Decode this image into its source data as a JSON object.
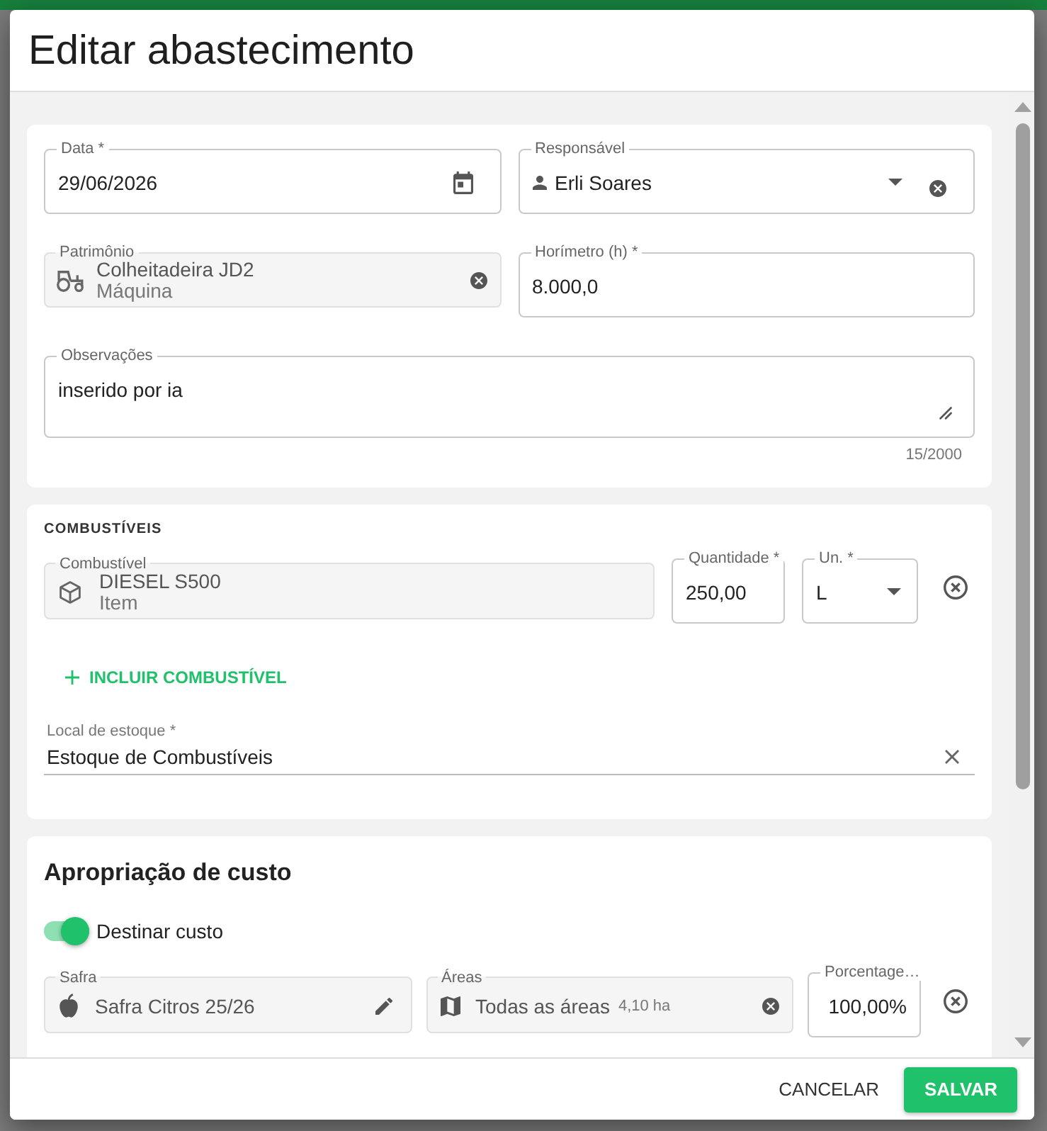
{
  "dialog": {
    "title": "Editar abastecimento"
  },
  "general": {
    "date": {
      "label": "Data *",
      "value": "29/06/2026"
    },
    "responsible": {
      "label": "Responsável",
      "value": "Erli Soares"
    },
    "asset": {
      "label": "Patrimônio",
      "name": "Colheitadeira JD2",
      "type": "Máquina"
    },
    "hour_meter": {
      "label": "Horímetro (h) *",
      "value": "8.000,0"
    },
    "notes": {
      "label": "Observações",
      "value": "inserido por ia",
      "counter": "15/2000"
    }
  },
  "fuels": {
    "heading": "COMBUSTÍVEIS",
    "items": [
      {
        "label": "Combustível",
        "name": "DIESEL S500",
        "type": "Item",
        "quantity_label": "Quantidade *",
        "quantity": "250,00",
        "unit_label": "Un. *",
        "unit": "L"
      }
    ],
    "add_button": "INCLUIR COMBUSTÍVEL",
    "stock": {
      "label": "Local de estoque *",
      "value": "Estoque de Combustíveis"
    }
  },
  "cost": {
    "heading": "Apropriação de custo",
    "toggle": {
      "label": "Destinar custo",
      "on": true
    },
    "rows": [
      {
        "season_label": "Safra",
        "season": "Safra Citros 25/26",
        "areas_label": "Áreas",
        "areas": "Todas as áreas",
        "area_size": "4,10 ha",
        "percent_label": "Porcentage…",
        "percent": "100,00%"
      }
    ]
  },
  "footer": {
    "buttons": [
      {
        "label": "CANCELAR",
        "kind": "text"
      },
      {
        "label": "SALVAR",
        "kind": "primary"
      }
    ]
  }
}
